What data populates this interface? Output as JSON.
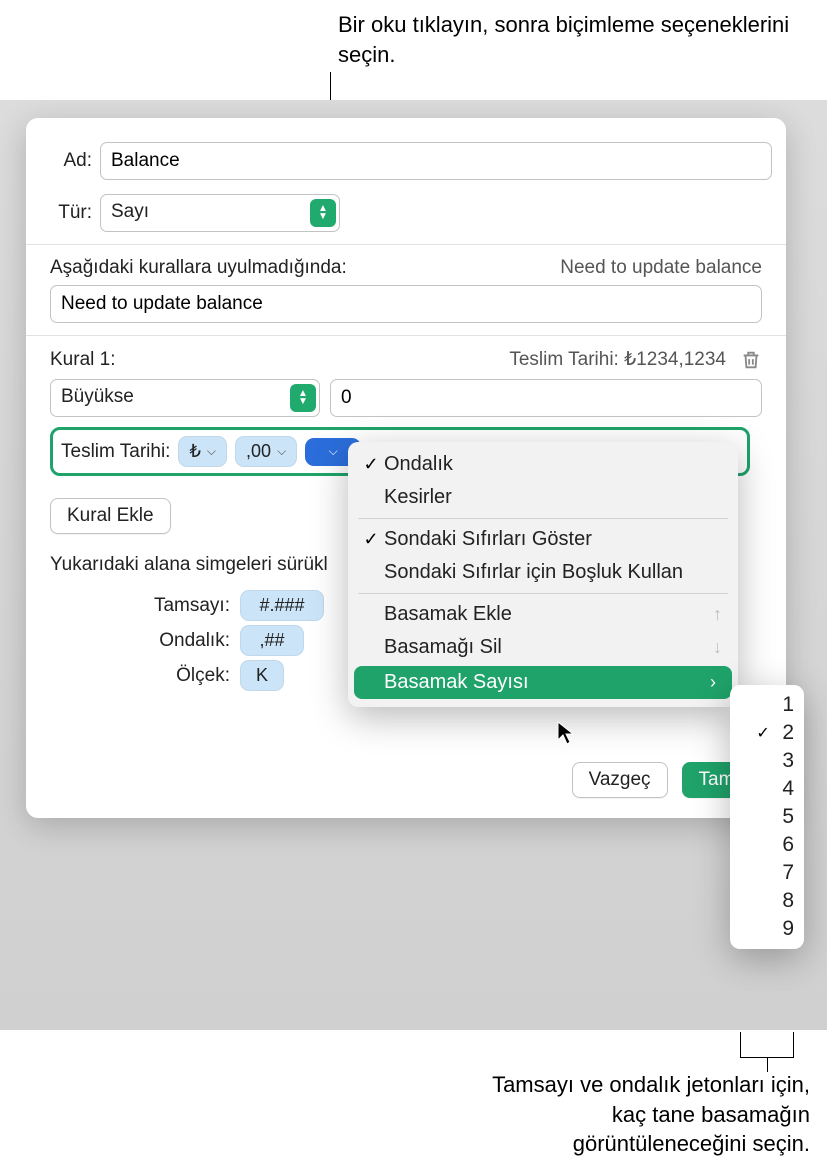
{
  "callouts": {
    "top": "Bir oku tıklayın, sonra biçimleme seçeneklerini seçin.",
    "bottom": "Tamsayı ve ondalık jetonları için, kaç tane basamağın görüntüleneceğini seçin."
  },
  "panel": {
    "name_label": "Ad:",
    "name_value": "Balance",
    "type_label": "Tür:",
    "type_value": "Sayı",
    "fallback_label": "Aşağıdaki kurallara uyulmadığında:",
    "fallback_preview": "Need to update balance",
    "fallback_value": "Need to update balance",
    "rule": {
      "label": "Kural 1:",
      "preview": "Teslim Tarihi: ₺1234,1234",
      "condition": "Büyükse",
      "value": "0",
      "token_label": "Teslim Tarihi:",
      "currency_chip": "₺",
      "decimal_chip": ",00"
    },
    "add_rule": "Kural Ekle",
    "drag_note": "Yukarıdaki alana simgeleri sürükl",
    "tokens": {
      "int_label": "Tamsayı:",
      "int_val": "#.###",
      "dec_label": "Ondalık:",
      "dec_val": ",##",
      "scale_label": "Ölçek:",
      "scale_val": "K"
    },
    "cancel": "Vazgeç",
    "ok": "Tama"
  },
  "menu": {
    "items": [
      {
        "label": "Ondalık",
        "checked": true
      },
      {
        "label": "Kesirler",
        "checked": false
      },
      {
        "sep": true
      },
      {
        "label": "Sondaki Sıfırları Göster",
        "checked": true
      },
      {
        "label": "Sondaki Sıfırlar için Boşluk Kullan",
        "checked": false
      },
      {
        "sep": true
      },
      {
        "label": "Basamak Ekle",
        "kbd": "↑"
      },
      {
        "label": "Basamağı Sil",
        "kbd": "↓"
      },
      {
        "label": "Basamak Sayısı",
        "submenu": true,
        "highlight": true
      }
    ]
  },
  "submenu": {
    "options": [
      "1",
      "2",
      "3",
      "4",
      "5",
      "6",
      "7",
      "8",
      "9"
    ],
    "selected": "2"
  }
}
